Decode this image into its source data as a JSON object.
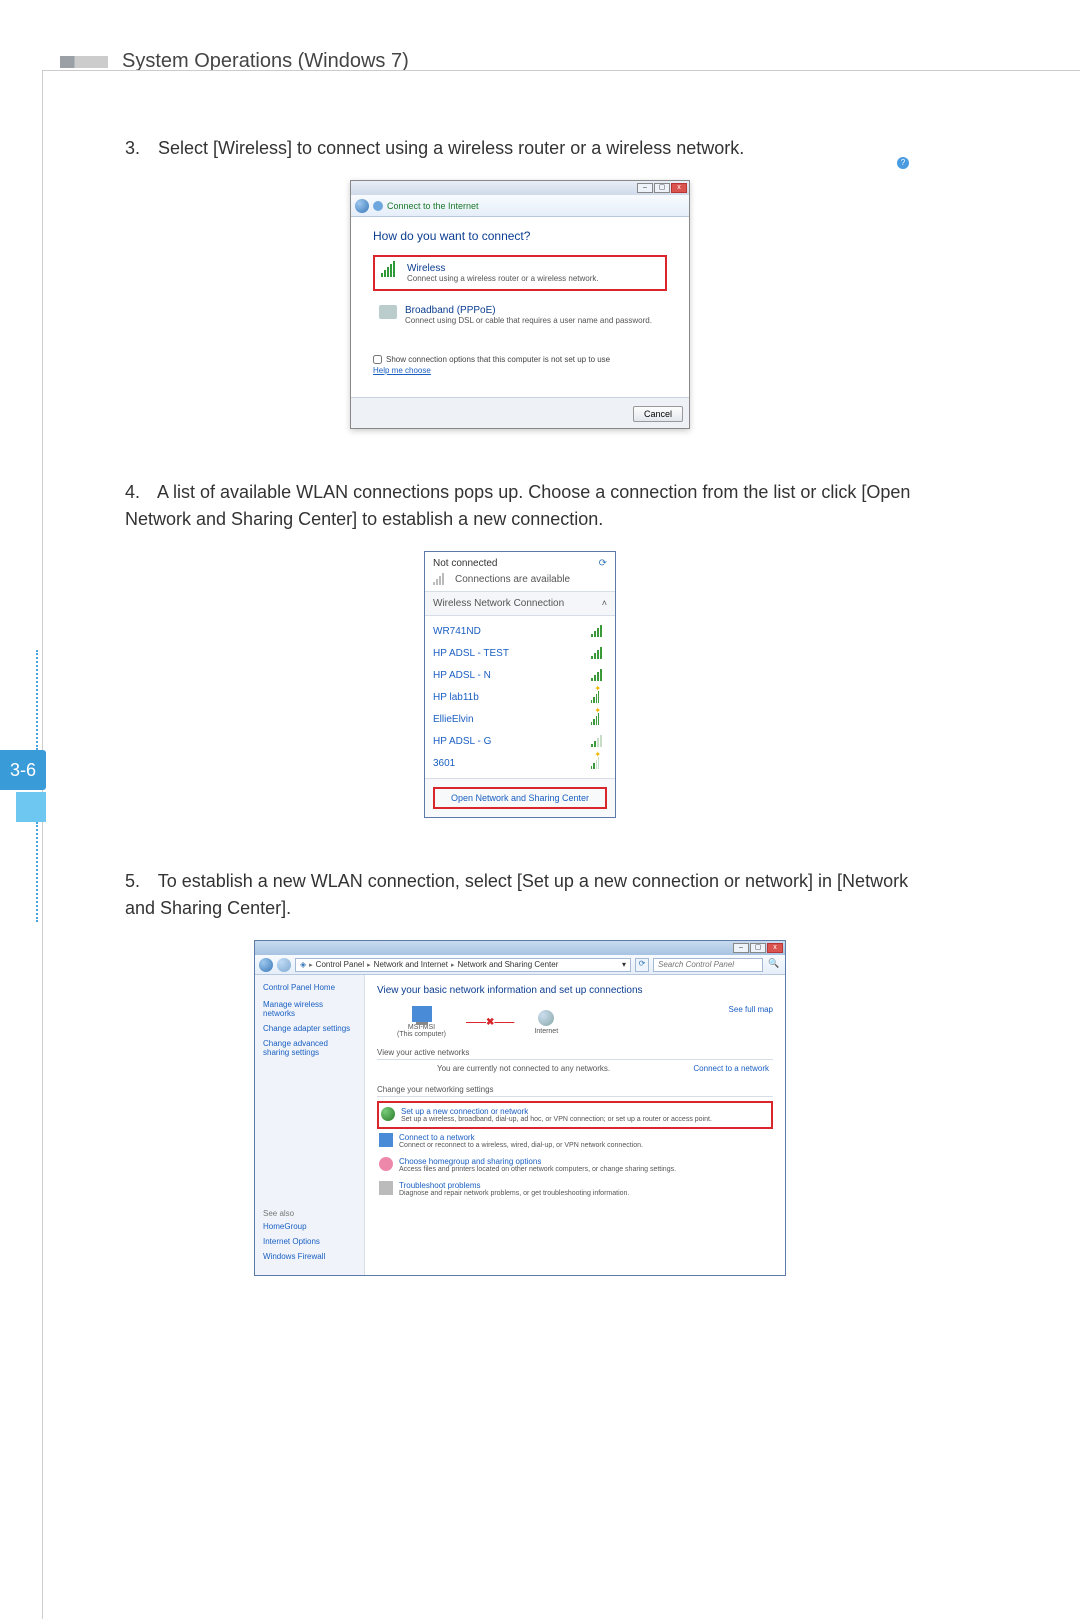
{
  "header": {
    "title": "System Operations (Windows 7)"
  },
  "sideTab": {
    "label": "3-6"
  },
  "steps": {
    "s3": {
      "num": "3.",
      "text": "Select [Wireless] to connect using a wireless router or a wireless network."
    },
    "s4": {
      "num": "4.",
      "text": "A list of available WLAN connections pops up. Choose a connection from the list or click [Open Network and Sharing Center] to establish a new connection."
    },
    "s5": {
      "num": "5.",
      "text": "To establish a new WLAN connection, select [Set up a new connection or network] in [Network and Sharing Center]."
    }
  },
  "fig1": {
    "crumb": "Connect to the Internet",
    "question": "How do you want to connect?",
    "wireless": {
      "title": "Wireless",
      "desc": "Connect using a wireless router or a wireless network."
    },
    "broadband": {
      "title": "Broadband (PPPoE)",
      "desc": "Connect using DSL or cable that requires a user name and password."
    },
    "showOpts": "Show connection options that this computer is not set up to use",
    "help": "Help me choose",
    "cancel": "Cancel"
  },
  "fig2": {
    "notConnected": "Not connected",
    "available": "Connections are available",
    "header": "Wireless Network Connection",
    "networks": [
      {
        "name": "WR741ND"
      },
      {
        "name": "HP ADSL - TEST"
      },
      {
        "name": "HP ADSL - N"
      },
      {
        "name": "HP lab11b"
      },
      {
        "name": "EllieElvin"
      },
      {
        "name": "HP ADSL - G"
      },
      {
        "name": "3601"
      }
    ],
    "openCenter": "Open Network and Sharing Center"
  },
  "fig3": {
    "path": {
      "p1": "Control Panel",
      "p2": "Network and Internet",
      "p3": "Network and Sharing Center"
    },
    "searchPlaceholder": "Search Control Panel",
    "side": {
      "home": "Control Panel Home",
      "links": [
        "Manage wireless networks",
        "Change adapter settings",
        "Change advanced sharing settings"
      ],
      "seeAlso": "See also",
      "seeAlsoLinks": [
        "HomeGroup",
        "Internet Options",
        "Windows Firewall"
      ]
    },
    "pane": {
      "title": "View your basic network information and set up connections",
      "fullMap": "See full map",
      "pcName": "MSI-MSI",
      "pcSub": "(This computer)",
      "internet": "Internet",
      "activeLabel": "View your active networks",
      "activeMsg": "You are currently not connected to any networks.",
      "connect": "Connect to a network",
      "changeHeader": "Change your networking settings",
      "items": [
        {
          "title": "Set up a new connection or network",
          "desc": "Set up a wireless, broadband, dial-up, ad hoc, or VPN connection; or set up a router or access point."
        },
        {
          "title": "Connect to a network",
          "desc": "Connect or reconnect to a wireless, wired, dial-up, or VPN network connection."
        },
        {
          "title": "Choose homegroup and sharing options",
          "desc": "Access files and printers located on other network computers, or change sharing settings."
        },
        {
          "title": "Troubleshoot problems",
          "desc": "Diagnose and repair network problems, or get troubleshooting information."
        }
      ]
    }
  }
}
